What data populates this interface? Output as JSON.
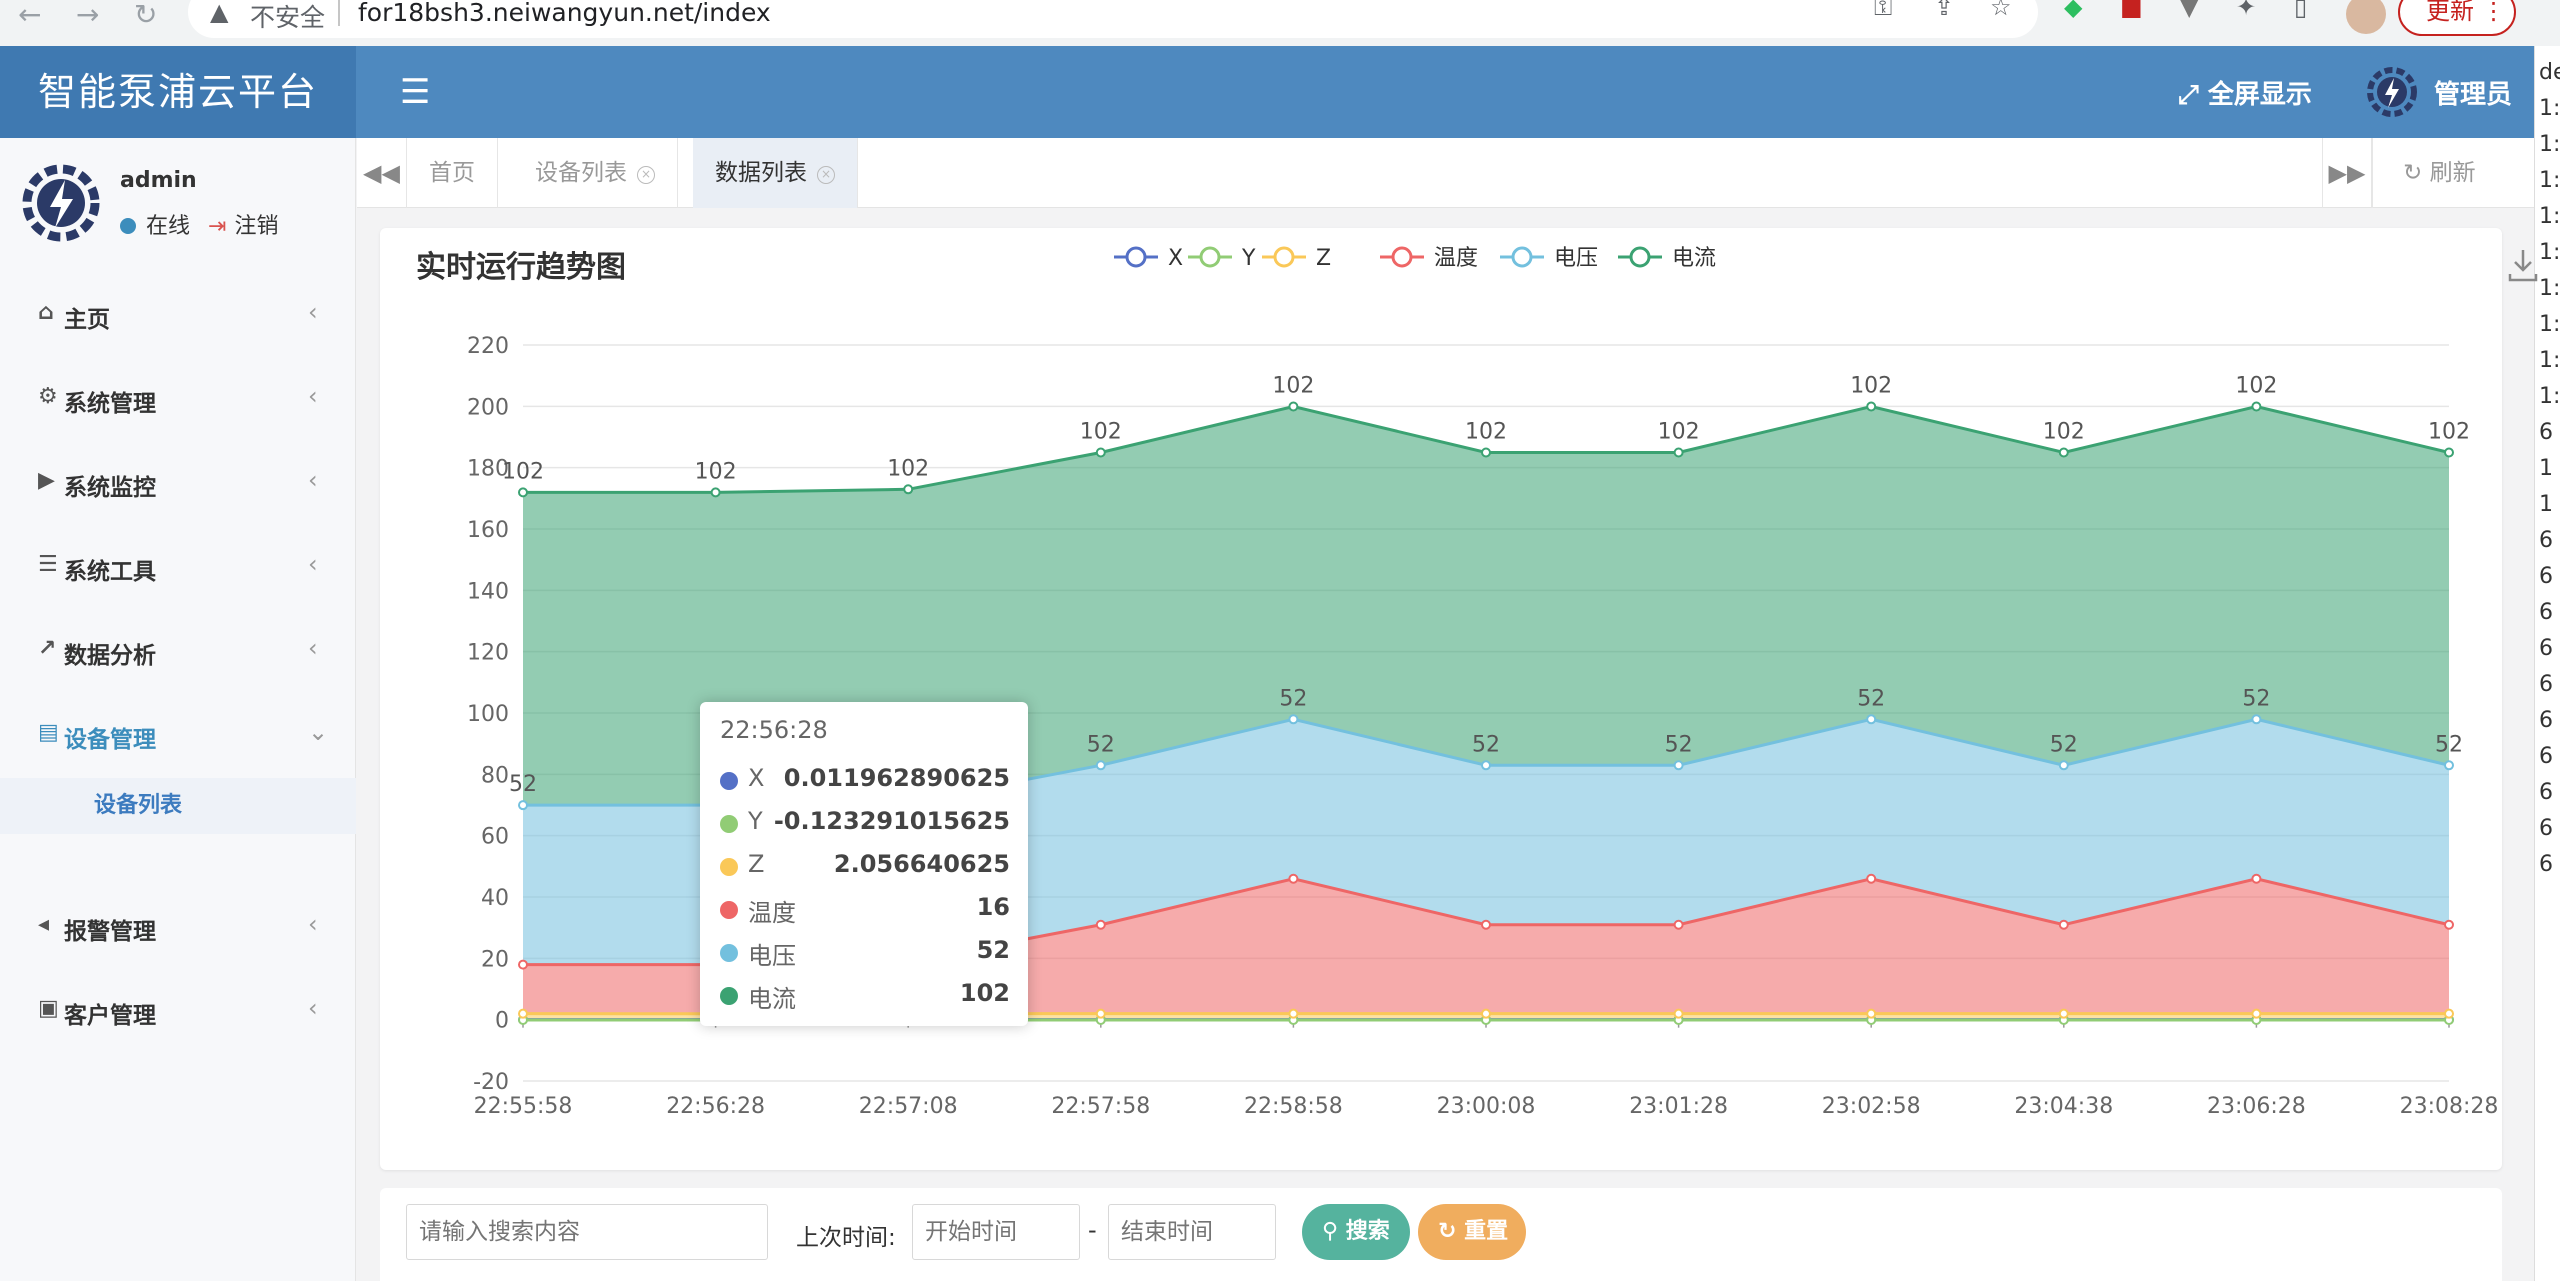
{
  "browser": {
    "back": "←",
    "forward": "→",
    "reload": "↻",
    "insecure_label": "不安全",
    "url": "for18bsh3.neiwangyun.net/index",
    "update_label": "更新"
  },
  "header": {
    "brand": "智能泵浦云平台",
    "fullscreen_label": "全屏显示",
    "admin_label": "管理员"
  },
  "user": {
    "name": "admin",
    "status": "在线",
    "logout": "注销"
  },
  "sidebar": {
    "items": [
      {
        "icon": "home-icon",
        "label": "主页"
      },
      {
        "icon": "gear-icon",
        "label": "系统管理"
      },
      {
        "icon": "video-camera-icon",
        "label": "系统监控"
      },
      {
        "icon": "list-icon",
        "label": "系统工具"
      },
      {
        "icon": "line-chart-icon",
        "label": "数据分析"
      },
      {
        "icon": "server-icon",
        "label": "设备管理"
      },
      {
        "icon": "volume-icon",
        "label": "报警管理"
      },
      {
        "icon": "contact-icon",
        "label": "客户管理"
      }
    ],
    "submenu_label": "设备列表"
  },
  "tabs": {
    "items": [
      "首页",
      "设备列表",
      "数据列表"
    ],
    "active_index": 2,
    "refresh_label": "刷新"
  },
  "chart": {
    "title": "实时运行趋势图",
    "tooltip": {
      "time": "22:56:28",
      "rows": [
        {
          "name": "X",
          "value": "0.011962890625",
          "color": "#5470c6"
        },
        {
          "name": "Y",
          "value": "-0.123291015625",
          "color": "#91cc75"
        },
        {
          "name": "Z",
          "value": "2.056640625",
          "color": "#fac858"
        },
        {
          "name": "温度",
          "value": "16",
          "color": "#ee6666"
        },
        {
          "name": "电压",
          "value": "52",
          "color": "#73c0de"
        },
        {
          "name": "电流",
          "value": "102",
          "color": "#3ba272"
        }
      ]
    }
  },
  "chart_data": {
    "type": "area",
    "stacked": true,
    "categories": [
      "22:55:58",
      "22:56:28",
      "22:57:08",
      "22:57:58",
      "22:58:58",
      "23:00:08",
      "23:01:28",
      "23:02:58",
      "23:04:38",
      "23:06:28",
      "23:08:28"
    ],
    "ylim": [
      -20,
      220
    ],
    "yticks": [
      -20,
      0,
      20,
      40,
      60,
      80,
      100,
      120,
      140,
      160,
      180,
      200,
      220
    ],
    "legend_position": "top-center",
    "grid": true,
    "series": [
      {
        "name": "X",
        "color": "#5470c6",
        "values": [
          0.01,
          0.011962890625,
          0.01,
          0.01,
          0.01,
          0.01,
          0.01,
          0.01,
          0.01,
          0.01,
          0.01
        ],
        "labels": false
      },
      {
        "name": "Y",
        "color": "#91cc75",
        "values": [
          -0.12,
          -0.123291015625,
          -0.12,
          -0.12,
          -0.12,
          -0.12,
          -0.12,
          -0.12,
          -0.12,
          -0.12,
          -0.12
        ],
        "labels": false
      },
      {
        "name": "Z",
        "color": "#fac858",
        "values": [
          2.06,
          2.056640625,
          2.06,
          2.06,
          2.06,
          2.06,
          2.06,
          2.06,
          2.06,
          2.06,
          2.06
        ],
        "labels": false
      },
      {
        "name": "温度",
        "color": "#ee6666",
        "values": [
          16,
          16,
          17,
          29,
          44,
          29,
          29,
          44,
          29,
          44,
          29
        ],
        "labels": false
      },
      {
        "name": "电压",
        "color": "#73c0de",
        "values": [
          52,
          52,
          52,
          52,
          52,
          52,
          52,
          52,
          52,
          52,
          52
        ],
        "labels": true
      },
      {
        "name": "电流",
        "color": "#3ba272",
        "values": [
          102,
          102,
          102,
          102,
          102,
          102,
          102,
          102,
          102,
          102,
          102
        ],
        "labels": true
      }
    ]
  },
  "search": {
    "placeholder": "请输入搜索内容",
    "last_time_label": "上次时间:",
    "start_placeholder": "开始时间",
    "dash": "-",
    "end_placeholder": "结束时间",
    "search_label": "搜索",
    "reset_label": "重置"
  },
  "side_strip": [
    "de",
    "1:",
    "1:",
    "1:",
    "1:",
    "1:",
    "1:",
    "1:",
    "1:",
    "1:",
    "6",
    "1",
    "1",
    "6",
    "6",
    "6",
    "6",
    "6",
    "6",
    "6",
    "6",
    "6",
    "6"
  ]
}
